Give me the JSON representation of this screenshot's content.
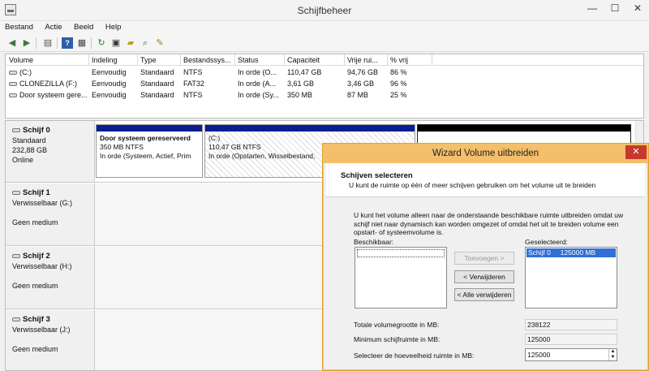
{
  "window": {
    "title": "Schijfbeheer",
    "controls": {
      "minimize": "—",
      "maximize": "☐",
      "close": "✕"
    }
  },
  "menu": [
    "Bestand",
    "Actie",
    "Beeld",
    "Help"
  ],
  "toolbar_icons": [
    "back-arrow-icon",
    "forward-arrow-icon",
    "volume-list-icon",
    "help-icon",
    "properties-icon",
    "refresh-icon",
    "open-folder-icon",
    "search-icon",
    "settings-icon"
  ],
  "volume_list": {
    "columns": [
      "Volume",
      "Indeling",
      "Type",
      "Bestandssys...",
      "Status",
      "Capaciteit",
      "Vrije rui...",
      "% vrij"
    ],
    "rows": [
      {
        "volume": "(C:)",
        "indeling": "Eenvoudig",
        "type": "Standaard",
        "fs": "NTFS",
        "status": "In orde (O...",
        "capaciteit": "110,47 GB",
        "vrij": "94,76 GB",
        "pct": "86 %"
      },
      {
        "volume": "CLONEZILLA (F:)",
        "indeling": "Eenvoudig",
        "type": "Standaard",
        "fs": "FAT32",
        "status": "In orde (A...",
        "capaciteit": "3,61 GB",
        "vrij": "3,46 GB",
        "pct": "96 %"
      },
      {
        "volume": "Door systeem gere...",
        "indeling": "Eenvoudig",
        "type": "Standaard",
        "fs": "NTFS",
        "status": "In orde (Sy...",
        "capaciteit": "350 MB",
        "vrij": "87 MB",
        "pct": "25 %"
      }
    ]
  },
  "disks": [
    {
      "name": "Schijf 0",
      "type": "Standaard",
      "size": "232,88 GB",
      "status": "Online",
      "partitions": [
        {
          "name": "Door systeem gereserveerd",
          "size": "350 MB NTFS",
          "status": "In orde (Systeem, Actief, Prim"
        },
        {
          "name": "(C:)",
          "size": "110,47 GB NTFS",
          "status": "In orde (Opstarten, Wisselbestand,"
        }
      ]
    },
    {
      "name": "Schijf 1",
      "type": "Verwisselbaar (G:)",
      "media": "Geen medium"
    },
    {
      "name": "Schijf 2",
      "type": "Verwisselbaar (H:)",
      "media": "Geen medium"
    },
    {
      "name": "Schijf 3",
      "type": "Verwisselbaar (J:)",
      "media": "Geen medium"
    }
  ],
  "wizard": {
    "title": "Wizard Volume uitbreiden",
    "close": "✕",
    "heading": "Schijven selecteren",
    "subheading": "U kunt de ruimte op één of meer schijven gebruiken om het volume uit te breiden",
    "description": "U kunt het volume alleen naar de onderstaande beschikbare ruimte uitbreiden omdat uw schijf niet naar dynamisch kan worden omgezet of omdat het uit te breiden volume een opstart- of systeemvolume is.",
    "available_label": "Beschikbaar:",
    "selected_label": "Geselecteerd:",
    "selected_items": [
      "Schijf 0     125000 MB"
    ],
    "add_button": "Toevoegen >",
    "remove_button": "< Verwijderen",
    "remove_all_button": "< Alle verwijderen",
    "total_label": "Totale volumegrootte in MB:",
    "total_value": "238122",
    "max_label": "Minimum schijfruimte in MB:",
    "max_value": "125000",
    "select_label": "Selecteer de hoeveelheid ruimte in MB:",
    "select_value": "125000"
  }
}
